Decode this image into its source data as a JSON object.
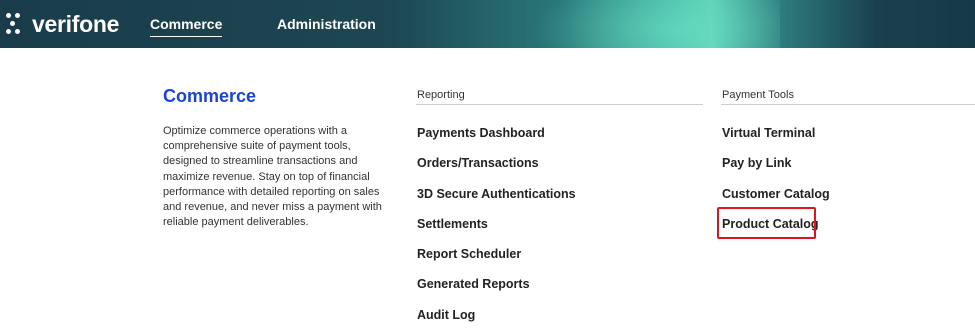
{
  "header": {
    "logo_text": "verifone",
    "nav": [
      {
        "label": "Commerce",
        "active": true
      },
      {
        "label": "Administration",
        "active": false
      }
    ]
  },
  "commerce": {
    "title": "Commerce",
    "description": "Optimize commerce operations with a comprehensive suite of payment tools, designed to streamline transactions and maximize revenue. Stay on top of financial performance with detailed reporting on sales and revenue, and never miss a payment with reliable payment deliverables."
  },
  "reporting": {
    "heading": "Reporting",
    "links": [
      "Payments Dashboard",
      "Orders/Transactions",
      "3D Secure Authentications",
      "Settlements",
      "Report Scheduler",
      "Generated Reports",
      "Audit Log"
    ]
  },
  "payment_tools": {
    "heading": "Payment Tools",
    "links": [
      "Virtual Terminal",
      "Pay by Link",
      "Customer Catalog",
      "Product Catalog"
    ],
    "highlighted": "Product Catalog"
  },
  "colors": {
    "accent_blue": "#1a44d8",
    "highlight_red": "#e0141e",
    "header_dark": "#1a3c4a",
    "header_teal": "#5fd0b6"
  }
}
